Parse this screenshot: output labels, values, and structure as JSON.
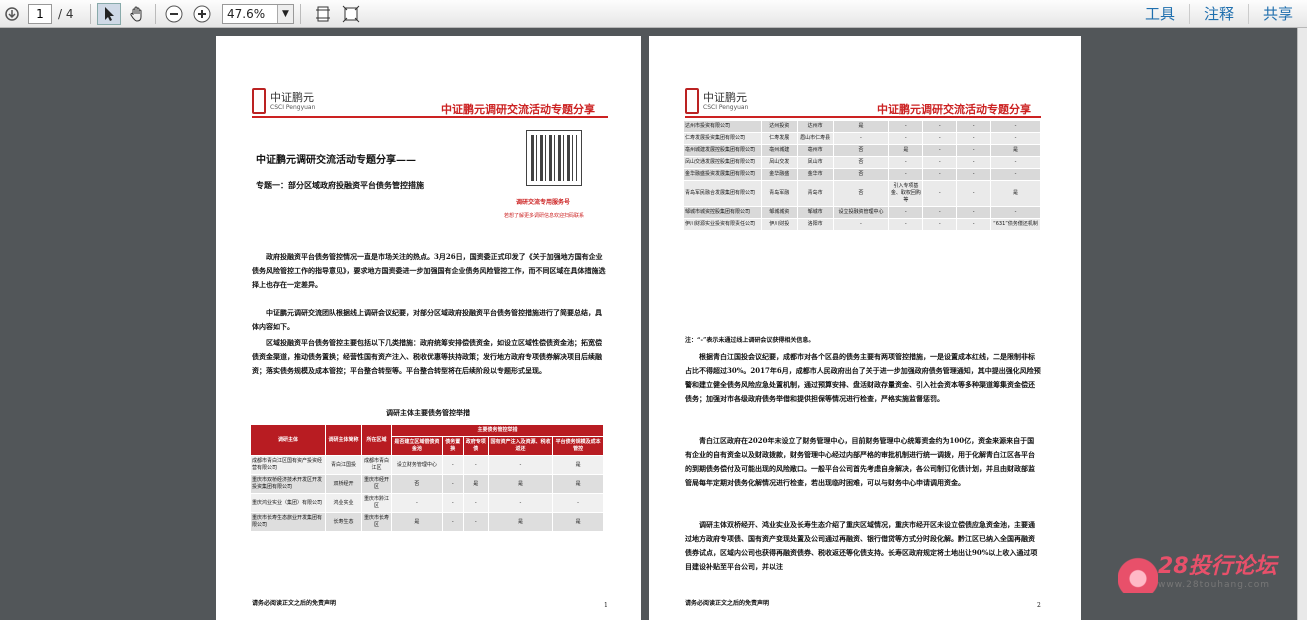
{
  "toolbar": {
    "page_current": "1",
    "page_total": "/ 4",
    "zoom": "47.6%",
    "menu": [
      "工具",
      "注释",
      "共享"
    ]
  },
  "page1": {
    "logo_cn": "中证鹏元",
    "logo_en": "CSCI Pengyuan",
    "header": "中证鹏元调研交流活动专题分享",
    "title": "中证鹏元调研交流活动专题分享——",
    "subtitle": "专题一：部分区域政府投融资平台债务管控措施",
    "qr_caption": "调研交流专用服务号",
    "qr_note": "若想了解更多调研信息欢迎扫码联系",
    "para1": "政府投融资平台债务管控情况一直是市场关注的热点。3月26日，国资委正式印发了《关于加强地方国有企业债务风险管控工作的指导意见》，要求地方国资委进一步加强国有企业债务风险管控工作，而不同区域在具体措施选择上也存在一定差异。",
    "para2": "中证鹏元调研交流团队根据线上调研会议纪要，对部分区域政府投融资平台债务管控措施进行了简要总结，具体内容如下。",
    "para3": "区域投融资平台债务管控主要包括以下几类措施：政府统筹安排偿债资金，如设立区域性偿债资金池；拓宽偿债资金渠道，推动债务置换；经营性国有资产注入、税收优惠等扶持政策；发行地方政府专项债券解决项目后续融资；落实债务规模及成本管控；平台整合转型等。平台整合转型将在后续阶段以专题形式呈现。",
    "table_title": "调研主体主要债务管控举措",
    "table_head": [
      "调研主体",
      "调研主体简称",
      "所在区域",
      "是否建立区域偿债资金池",
      "债务置换",
      "政府专项债",
      "国有资产注入及资源、税收返还",
      "平台债务规模及成本管控"
    ],
    "table_group": "主要债务管控举措",
    "rows": [
      [
        "成都市青白江区国有资产投资经营有限公司",
        "青白江国投",
        "成都市青白江区",
        "设立财务管理中心",
        "-",
        "-",
        "-",
        "是"
      ],
      [
        "重庆市双桥经济技术开发区开发投资集团有限公司",
        "双桥经开",
        "重庆市经开区",
        "否",
        "-",
        "是",
        "是",
        "是"
      ],
      [
        "重庆鸿业实业（集团）有限公司",
        "鸿业实业",
        "重庆市黔江区",
        "-",
        "-",
        "-",
        "-",
        "-"
      ],
      [
        "重庆市长寿生态旅业开发集团有限公司",
        "长寿生态",
        "重庆市长寿区",
        "是",
        "-",
        "-",
        "是",
        "是"
      ]
    ],
    "footer": "请务必阅读正文之后的免责声明",
    "page_no": "1"
  },
  "page2": {
    "header": "中证鹏元调研交流活动专题分享",
    "rows": [
      [
        "达州市投资有限公司",
        "达州投资",
        "达州市",
        "是",
        "-",
        "-",
        "-",
        "-"
      ],
      [
        "仁寿发展投资集团有限公司",
        "仁寿发展",
        "眉山市仁寿县",
        "-",
        "-",
        "-",
        "-",
        "-"
      ],
      [
        "亳州城建发展控股集团有限公司",
        "亳州城建",
        "亳州市",
        "否",
        "是",
        "-",
        "-",
        "是"
      ],
      [
        "凤山交通发展控股集团有限公司",
        "凤山交发",
        "凤山市",
        "否",
        "-",
        "-",
        "-",
        "-"
      ],
      [
        "金华融盛投资发展集团有限公司",
        "金华融盛",
        "金华市",
        "否",
        "-",
        "-",
        "-",
        "-"
      ],
      [
        "青岛军民融合发展集团有限公司",
        "青岛军融",
        "青岛市",
        "否",
        "引入专项基金、取权回购等",
        "-",
        "-",
        "是"
      ],
      [
        "邹城市城资控股集团有限公司",
        "邹城城资",
        "邹城市",
        "设立投融资管理中心",
        "-",
        "-",
        "-",
        "-"
      ],
      [
        "伊川财源实业投资有限责任公司",
        "伊川财投",
        "洛阳市",
        "-",
        "-",
        "-",
        "-",
        "“631”债务偿还机制"
      ]
    ],
    "note": "注：“-”表示未通过线上调研会议获得相关信息。",
    "para1": "根据青白江国投会议纪要，成都市对各个区县的债务主要有两项管控措施，一是设置成本红线，二是限制非标占比不得超过30%。2017年6月，成都市人民政府出台了关于进一步加强政府债务管理通知，其中提出强化风险预警和建立健全债务风险应急处置机制，通过预算安排、盘活财政存量资金、引入社会资本等多种渠道筹集资金偿还债务；加强对市各级政府债务举借和提供担保等情况进行检查，严格实施监督惩罚。",
    "para2": "青白江区政府在2020年末设立了财务管理中心，目前财务管理中心统筹资金约为100亿，资金来源来自于国有企业的自有资金以及财政拨款，财务管理中心经过内部严格的审批机制进行统一调拨，用于化解青白江区各平台的到期债务偿付及可能出现的风险敞口。一般平台公司首先考虑自身解决，各公司制订化债计划，并且由财政部监管局每年定期对债务化解情况进行检查，若出现临时困难，可以与财务中心申请调用资金。",
    "para3": "调研主体双桥经开、鸿业实业及长寿生态介绍了重庆区域情况，重庆市经开区未设立偿债应急资金池，主要通过地方政府专项债、国有资产变现处置及公司通过再融资、银行借贷等方式分时段化解。黔江区已纳入全国再融资债券试点，区域内公司也获得再融资债券、税收返还等化债支持。长寿区政府规定将土地出让90%以上收入通过项目建设补贴至平台公司，并以注",
    "footer": "请务必阅读正文之后的免责声明",
    "page_no": "2"
  },
  "watermark": {
    "name": "28投行论坛",
    "url": "www.28touhang.com"
  },
  "colors": {
    "accent": "#c22",
    "link": "#1f6fae"
  }
}
